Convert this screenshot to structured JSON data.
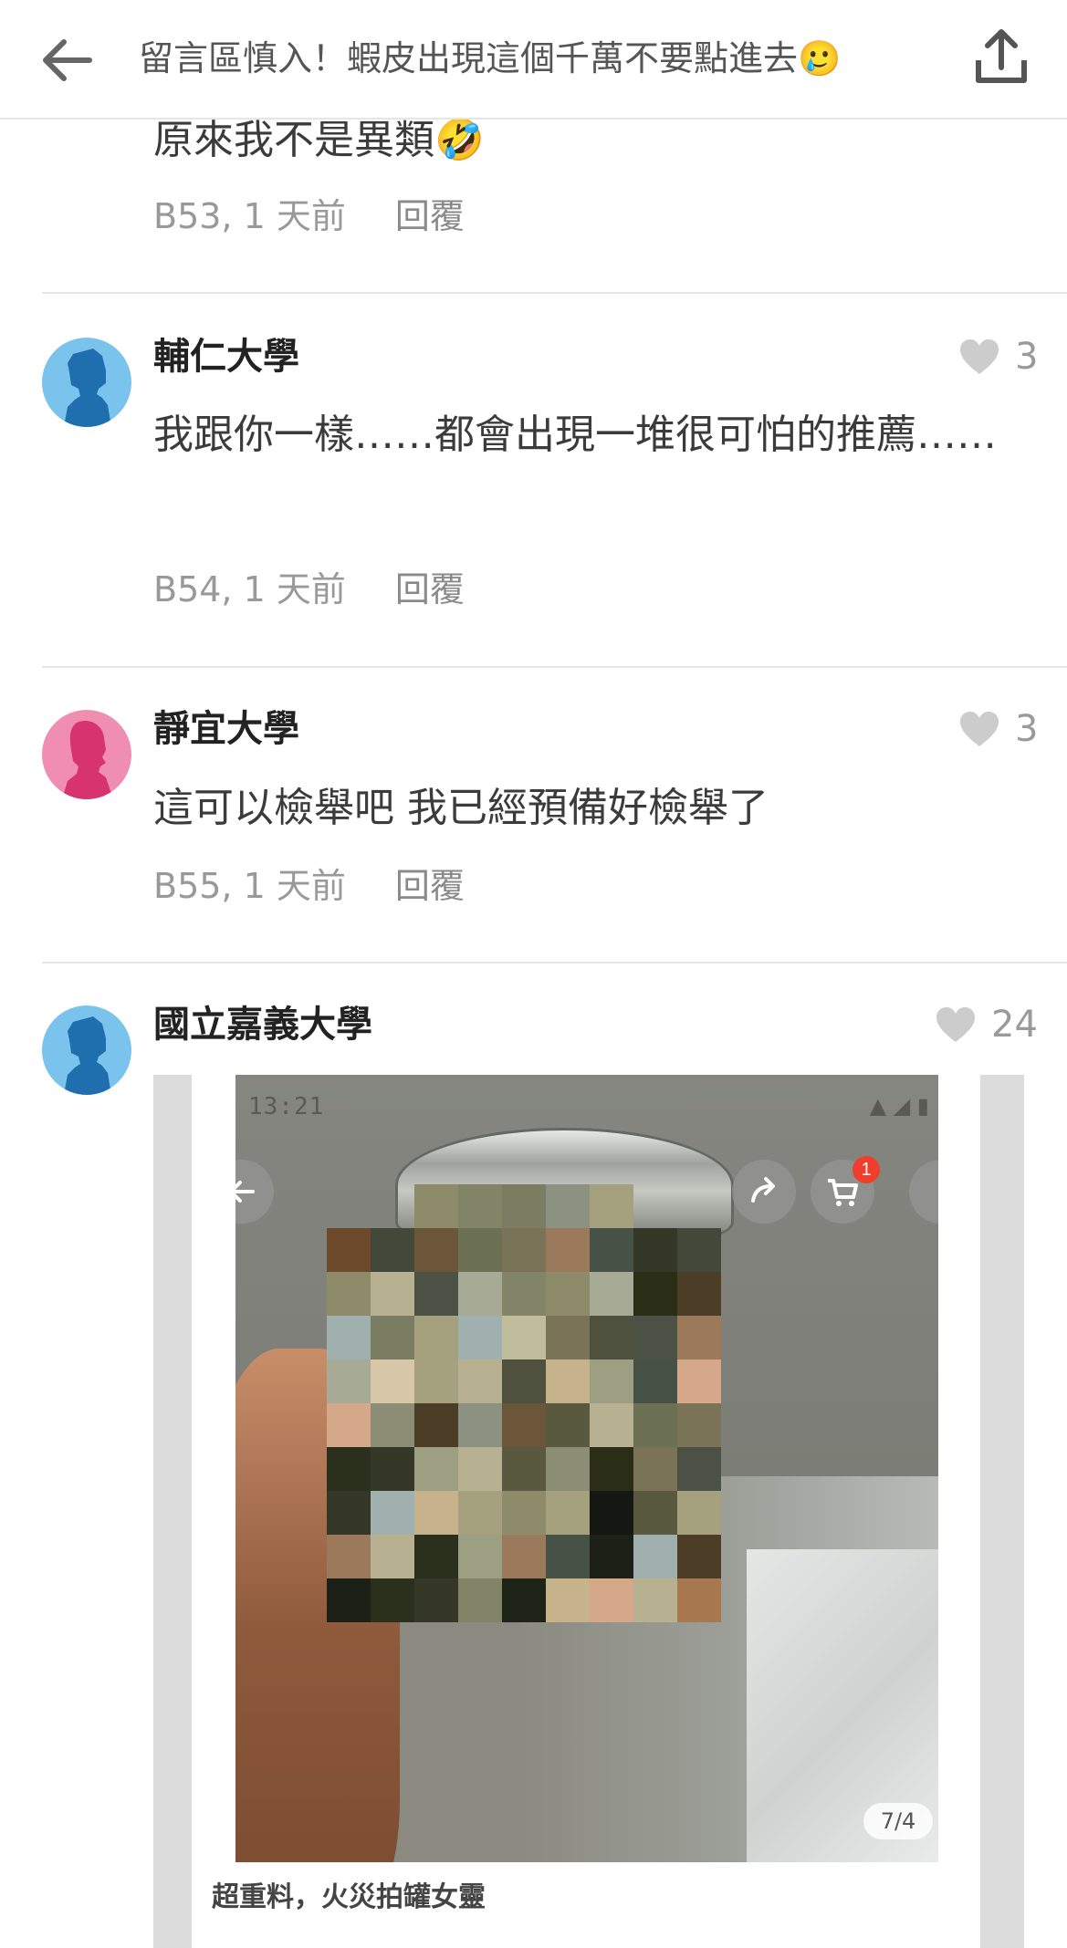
{
  "header": {
    "title": "留言區慎入！蝦皮出現這個千萬不要點進去🥲",
    "back_icon": "arrow-left-icon",
    "share_icon": "share-upload-icon"
  },
  "comments": [
    {
      "text": "原來我不是異類🤣",
      "meta": "B53, 1 天前",
      "reply": "回覆"
    },
    {
      "school": "輔仁大學",
      "likes": "3",
      "text": "我跟你一樣……都會出現一堆很可怕的推薦……",
      "meta": "B54, 1 天前",
      "reply": "回覆",
      "avatar": "male-avatar-icon",
      "avatar_color": "#79c3ec"
    },
    {
      "school": "靜宜大學",
      "likes": "3",
      "text": "這可以檢舉吧 我已經預備好檢舉了",
      "meta": "B55, 1 天前",
      "reply": "回覆",
      "avatar": "female-avatar-icon",
      "avatar_color": "#f08eb2"
    },
    {
      "school": "國立嘉義大學",
      "likes": "24",
      "avatar": "male-avatar-icon",
      "avatar_color": "#79c3ec",
      "image": {
        "status_time": "13:21",
        "cart_badge": "1",
        "page_indicator": "7/4",
        "caption": "超重料，火災拍罐女靈"
      }
    }
  ],
  "colors": {
    "meta_gray": "#999999",
    "like_gray": "#cccccc",
    "divider": "#e6e6e6"
  }
}
